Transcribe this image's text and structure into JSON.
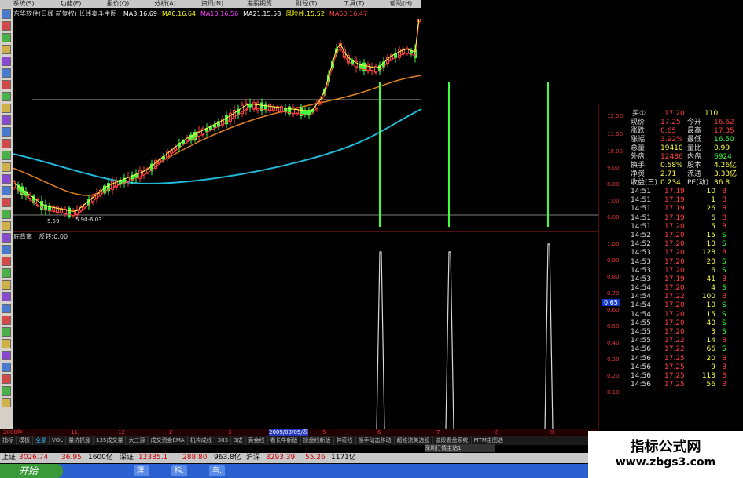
{
  "menu": [
    "系统(S)",
    "功能(F)",
    "报价(Q)",
    "分析(A)",
    "资讯(N)",
    "港股期货",
    "财经(T)",
    "工具(T)",
    "帮助(H)"
  ],
  "title_line": {
    "app": "东华软件(日线 前复权) 长线泰斗主图",
    "ma": [
      {
        "label": "MA3:16.69",
        "color": "#ffffff"
      },
      {
        "label": "MA6:16.64",
        "color": "#ffff00"
      },
      {
        "label": "MA10:16.56",
        "color": "#ff40ff"
      },
      {
        "label": "MA21:15.58",
        "color": "#ffffff"
      },
      {
        "label": "风险线:15.52",
        "color": "#ffff00"
      },
      {
        "label": "MA60:16.47",
        "color": "#ff4040"
      }
    ]
  },
  "chart": {
    "low_label": "5.59",
    "range_label": "5.90-6.03",
    "indicator_name": "底背离",
    "indicator_value": "反转:0.00",
    "indicator_side_value": "0.65",
    "date_label": "2009/03/05/四",
    "month_labels": [
      "2008年",
      "11",
      "12",
      "2",
      "3",
      "4",
      "5",
      "6",
      "7",
      "8",
      "9"
    ]
  },
  "right_axis_ticks": [
    "12.00",
    "11.00",
    "10.00",
    "9.00",
    "8.00",
    "7.00",
    "6.00",
    "1.00",
    "0.90",
    "0.80",
    "0.70",
    "0.60",
    "0.50",
    "0.40",
    "0.30",
    "0.20",
    "0.10"
  ],
  "quote": {
    "buy1": {
      "label": "买①",
      "price": "17.20",
      "vol": "110"
    },
    "rows": [
      {
        "l1": "现价",
        "v1": "17.25",
        "l2": "今开",
        "v2": "16.62",
        "c1": "#ff4040",
        "c2": "#ff4040"
      },
      {
        "l1": "涨跌",
        "v1": "0.65",
        "l2": "最高",
        "v2": "17.35",
        "c1": "#ff4040",
        "c2": "#ff4040"
      },
      {
        "l1": "涨幅",
        "v1": "3.92%",
        "l2": "最低",
        "v2": "16.50",
        "c1": "#ff4040",
        "c2": "#40ff40"
      },
      {
        "l1": "总量",
        "v1": "19410",
        "l2": "量比",
        "v2": "0.99",
        "c1": "#ffff40",
        "c2": "#ffff40"
      },
      {
        "l1": "外盘",
        "v1": "12486",
        "l2": "内盘",
        "v2": "6924",
        "c1": "#ff4040",
        "c2": "#40ff40"
      },
      {
        "l1": "换手",
        "v1": "0.58%",
        "l2": "股本",
        "v2": "4.26亿",
        "c1": "#ffff40",
        "c2": "#ffff40"
      },
      {
        "l1": "净资",
        "v1": "2.71",
        "l2": "流通",
        "v2": "3.33亿",
        "c1": "#ffff40",
        "c2": "#ffff40"
      },
      {
        "l1": "收益(三)",
        "v1": "0.234",
        "l2": "PE(动)",
        "v2": "36.8",
        "c1": "#ffff40",
        "c2": "#ffff40"
      }
    ]
  },
  "ticks": [
    {
      "t": "14:51",
      "p": "17.19",
      "v": "10",
      "s": "B"
    },
    {
      "t": "14:51",
      "p": "17.19",
      "v": "1",
      "s": "B"
    },
    {
      "t": "14:51",
      "p": "17.19",
      "v": "26",
      "s": "B"
    },
    {
      "t": "14:51",
      "p": "17.19",
      "v": "6",
      "s": "B"
    },
    {
      "t": "14:51",
      "p": "17.20",
      "v": "5",
      "s": "B"
    },
    {
      "t": "14:52",
      "p": "17.20",
      "v": "15",
      "s": "S"
    },
    {
      "t": "14:52",
      "p": "17.20",
      "v": "10",
      "s": "S"
    },
    {
      "t": "14:53",
      "p": "17.20",
      "v": "128",
      "s": "B"
    },
    {
      "t": "14:53",
      "p": "17.20",
      "v": "20",
      "s": "S"
    },
    {
      "t": "14:53",
      "p": "17.20",
      "v": "6",
      "s": "S"
    },
    {
      "t": "14:53",
      "p": "17.19",
      "v": "41",
      "s": "B"
    },
    {
      "t": "14:54",
      "p": "17.20",
      "v": "4",
      "s": "S"
    },
    {
      "t": "14:54",
      "p": "17.22",
      "v": "100",
      "s": "B"
    },
    {
      "t": "14:54",
      "p": "17.20",
      "v": "10",
      "s": "S"
    },
    {
      "t": "14:54",
      "p": "17.20",
      "v": "15",
      "s": "S"
    },
    {
      "t": "14:55",
      "p": "17.20",
      "v": "40",
      "s": "S"
    },
    {
      "t": "14:55",
      "p": "17.20",
      "v": "3",
      "s": "S"
    },
    {
      "t": "14:55",
      "p": "17.22",
      "v": "14",
      "s": "B"
    },
    {
      "t": "14:56",
      "p": "17.22",
      "v": "66",
      "s": "S"
    },
    {
      "t": "14:56",
      "p": "17.25",
      "v": "20",
      "s": "B"
    },
    {
      "t": "14:56",
      "p": "17.25",
      "v": "9",
      "s": "B"
    },
    {
      "t": "14:56",
      "p": "17.25",
      "v": "113",
      "s": "B"
    },
    {
      "t": "14:56",
      "p": "17.25",
      "v": "56",
      "s": "B"
    }
  ],
  "tabs": [
    "指标",
    "模板",
    "全部",
    "VOL",
    "量坑抓涨",
    "135成交量",
    "大三源",
    "成交资金EMA",
    "机构成线",
    "303",
    "3成",
    "黄金线",
    "看长牛新版",
    "操盘线新版",
    "神奇线",
    "换手动态移动",
    "超维流美选股",
    "波段看盘系统",
    "MTM主图选"
  ],
  "status_tab": "深圳行情主站1",
  "index_bar": {
    "sh_label": "上证",
    "sh_val": "3026.74",
    "sh_chg": "36.95",
    "sh_amt": "1600亿",
    "sz_label": "深证",
    "sz_val": "12385.1",
    "sz_chg": "288.80",
    "sz_amt": "963.8亿",
    "hs_label": "沪深",
    "hs_val": "3293.39",
    "hs_chg": "55.26",
    "hs_amt": "1171亿"
  },
  "taskbar": {
    "start": "开始",
    "items": [
      "理.",
      "指.",
      "鸟."
    ]
  },
  "watermark": {
    "line1": "指标公式网",
    "line2": "www.zbgs3.com"
  },
  "colors": {
    "up": "#ff4040",
    "down": "#40ff40",
    "bg": "#000000",
    "ma_blue": "#20b8d8",
    "ma_orange": "#e08020",
    "signal_green": "#40ff40"
  }
}
